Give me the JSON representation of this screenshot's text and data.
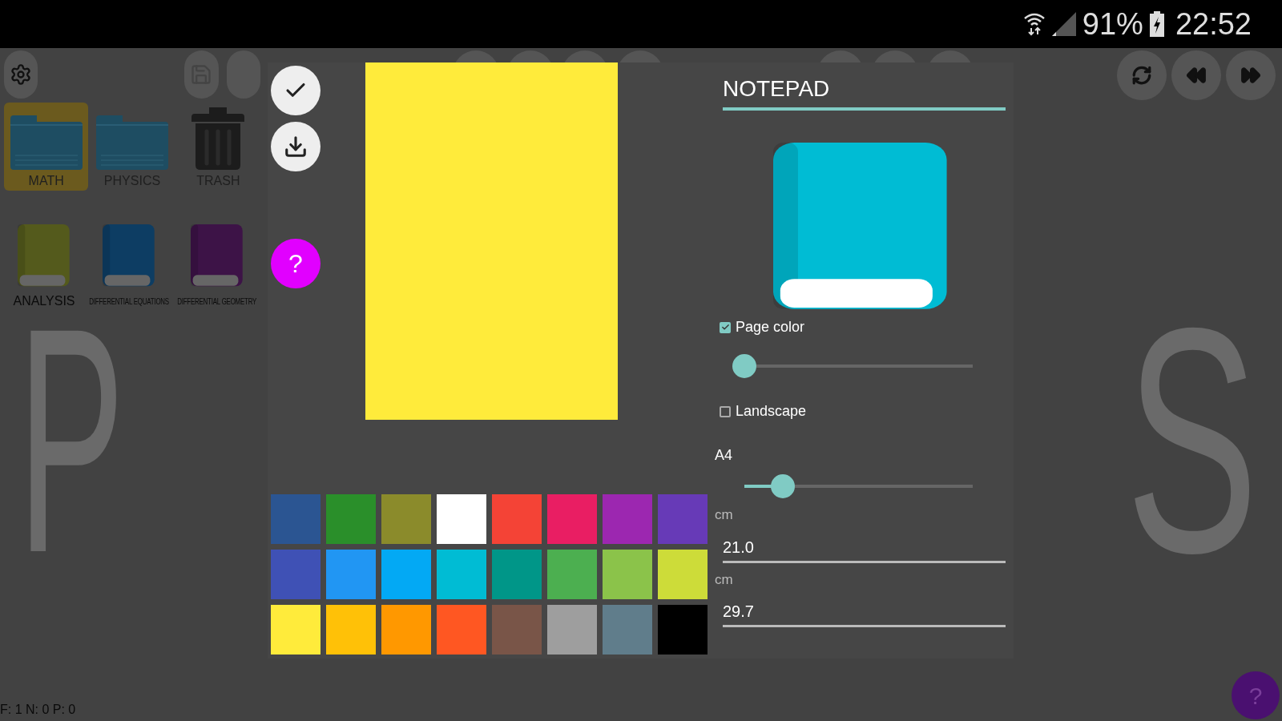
{
  "status_bar": {
    "battery": "91%",
    "time": "22:52"
  },
  "home": {
    "folders": [
      {
        "label": "MATH",
        "kind": "folder",
        "selected": true
      },
      {
        "label": "PHYSICS",
        "kind": "folder",
        "selected": false
      },
      {
        "label": "TRASH",
        "kind": "trash",
        "selected": false
      }
    ],
    "notebooks": [
      {
        "label": "ANALYSIS",
        "color": "#545a1c"
      },
      {
        "label": "DIFFERENTIAL EQUATIONS",
        "color": "#0d3d63"
      },
      {
        "label": "DIFFERENTIAL GEOMETRY",
        "color": "#3d1347"
      }
    ],
    "background_letters": [
      "P",
      "S"
    ],
    "counter": "F: 1 N: 0 P: 0"
  },
  "dialog": {
    "title": "NOTEPAD",
    "page_preview": {
      "color": "#ffeb3b"
    },
    "cover": {
      "color": "#00bcd4"
    },
    "help_button": "?",
    "palette": [
      {
        "color": "#2b5592"
      },
      {
        "color": "#2a8f2a"
      },
      {
        "color": "#8b8b2b"
      },
      {
        "color": "#ffffff"
      },
      {
        "color": "#f44336"
      },
      {
        "color": "#e91e63"
      },
      {
        "color": "#9c27b0"
      },
      {
        "color": "#673ab7"
      },
      {
        "color": "#3f51b5"
      },
      {
        "color": "#2196f3"
      },
      {
        "color": "#03a9f4"
      },
      {
        "color": "#00bcd4"
      },
      {
        "color": "#009688"
      },
      {
        "color": "#4caf50"
      },
      {
        "color": "#8bc34a"
      },
      {
        "color": "#cddc39"
      },
      {
        "color": "#ffeb3b"
      },
      {
        "color": "#ffc107"
      },
      {
        "color": "#ff9800"
      },
      {
        "color": "#ff5722"
      },
      {
        "color": "#795548"
      },
      {
        "color": "#9e9e9e"
      },
      {
        "color": "#607d8b"
      },
      {
        "color": "#000000"
      }
    ],
    "page_color": {
      "label": "Page color",
      "checked": true,
      "level": 0
    },
    "landscape": {
      "label": "Landscape",
      "checked": false
    },
    "paper_size": {
      "label": "A4",
      "level": 0.17
    },
    "width": {
      "unit": "cm",
      "value": "21.0"
    },
    "height": {
      "unit": "cm",
      "value": "29.7"
    }
  },
  "corner_help": "?"
}
